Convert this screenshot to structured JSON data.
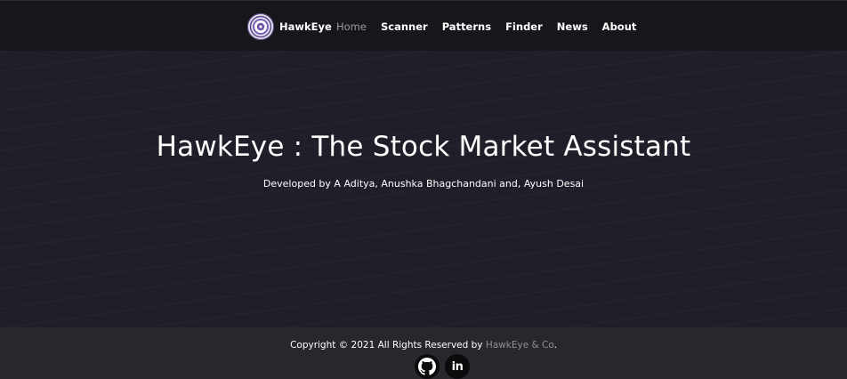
{
  "navbar": {
    "brand": "HawkEye",
    "links": [
      {
        "label": "Home",
        "active": true
      },
      {
        "label": "Scanner"
      },
      {
        "label": "Patterns"
      },
      {
        "label": "Finder"
      },
      {
        "label": "News"
      },
      {
        "label": "About"
      }
    ]
  },
  "hero": {
    "title": "HawkEye : The Stock Market Assistant",
    "subtitle": "Developed by A Aditya, Anushka Bhagchandani and, Ayush Desai"
  },
  "footer": {
    "copyright_prefix": "Copyright © 2021 All Rights Reserved by ",
    "company": "HawkEye & Co",
    "suffix": ".",
    "social": [
      {
        "icon": "github-icon"
      },
      {
        "icon": "linkedin-icon",
        "label": "in"
      }
    ]
  },
  "colors": {
    "nav_bg": "#16161b",
    "hero_bg": "#201f29",
    "footer_bg": "#28282c",
    "active_link": "#9a9aa2",
    "company_link": "#8e8e95",
    "logo_accent": "#6a4fa3"
  }
}
